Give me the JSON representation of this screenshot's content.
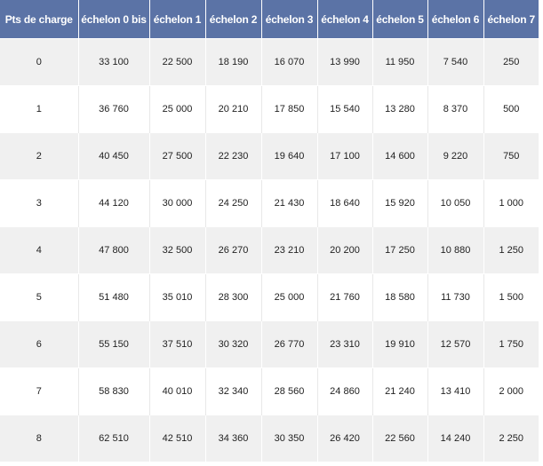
{
  "table": {
    "headers": [
      "Pts de charge",
      "échelon 0 bis",
      "échelon 1",
      "échelon 2",
      "échelon 3",
      "échelon 4",
      "échelon 5",
      "échelon 6",
      "échelon 7"
    ],
    "rows": [
      [
        "0",
        "33 100",
        "22 500",
        "18 190",
        "16 070",
        "13 990",
        "11 950",
        "7 540",
        "250"
      ],
      [
        "1",
        "36 760",
        "25 000",
        "20 210",
        "17 850",
        "15 540",
        "13 280",
        "8 370",
        "500"
      ],
      [
        "2",
        "40 450",
        "27 500",
        "22 230",
        "19 640",
        "17 100",
        "14 600",
        "9 220",
        "750"
      ],
      [
        "3",
        "44 120",
        "30 000",
        "24 250",
        "21 430",
        "18 640",
        "15 920",
        "10 050",
        "1 000"
      ],
      [
        "4",
        "47 800",
        "32 500",
        "26 270",
        "23 210",
        "20 200",
        "17 250",
        "10 880",
        "1 250"
      ],
      [
        "5",
        "51 480",
        "35 010",
        "28 300",
        "25 000",
        "21 760",
        "18 580",
        "11 730",
        "1 500"
      ],
      [
        "6",
        "55 150",
        "37 510",
        "30 320",
        "26 770",
        "23 310",
        "19 910",
        "12 570",
        "1 750"
      ],
      [
        "7",
        "58 830",
        "40 010",
        "32 340",
        "28 560",
        "24 860",
        "21 240",
        "13 410",
        "2 000"
      ],
      [
        "8",
        "62 510",
        "42 510",
        "34 360",
        "30 350",
        "26 420",
        "22 560",
        "14 240",
        "2 250"
      ]
    ]
  },
  "colors": {
    "header_bg": "#5b73a6",
    "header_text": "#ffffff",
    "row_alt_bg": "#f0f0f0",
    "row_bg": "#ffffff"
  }
}
